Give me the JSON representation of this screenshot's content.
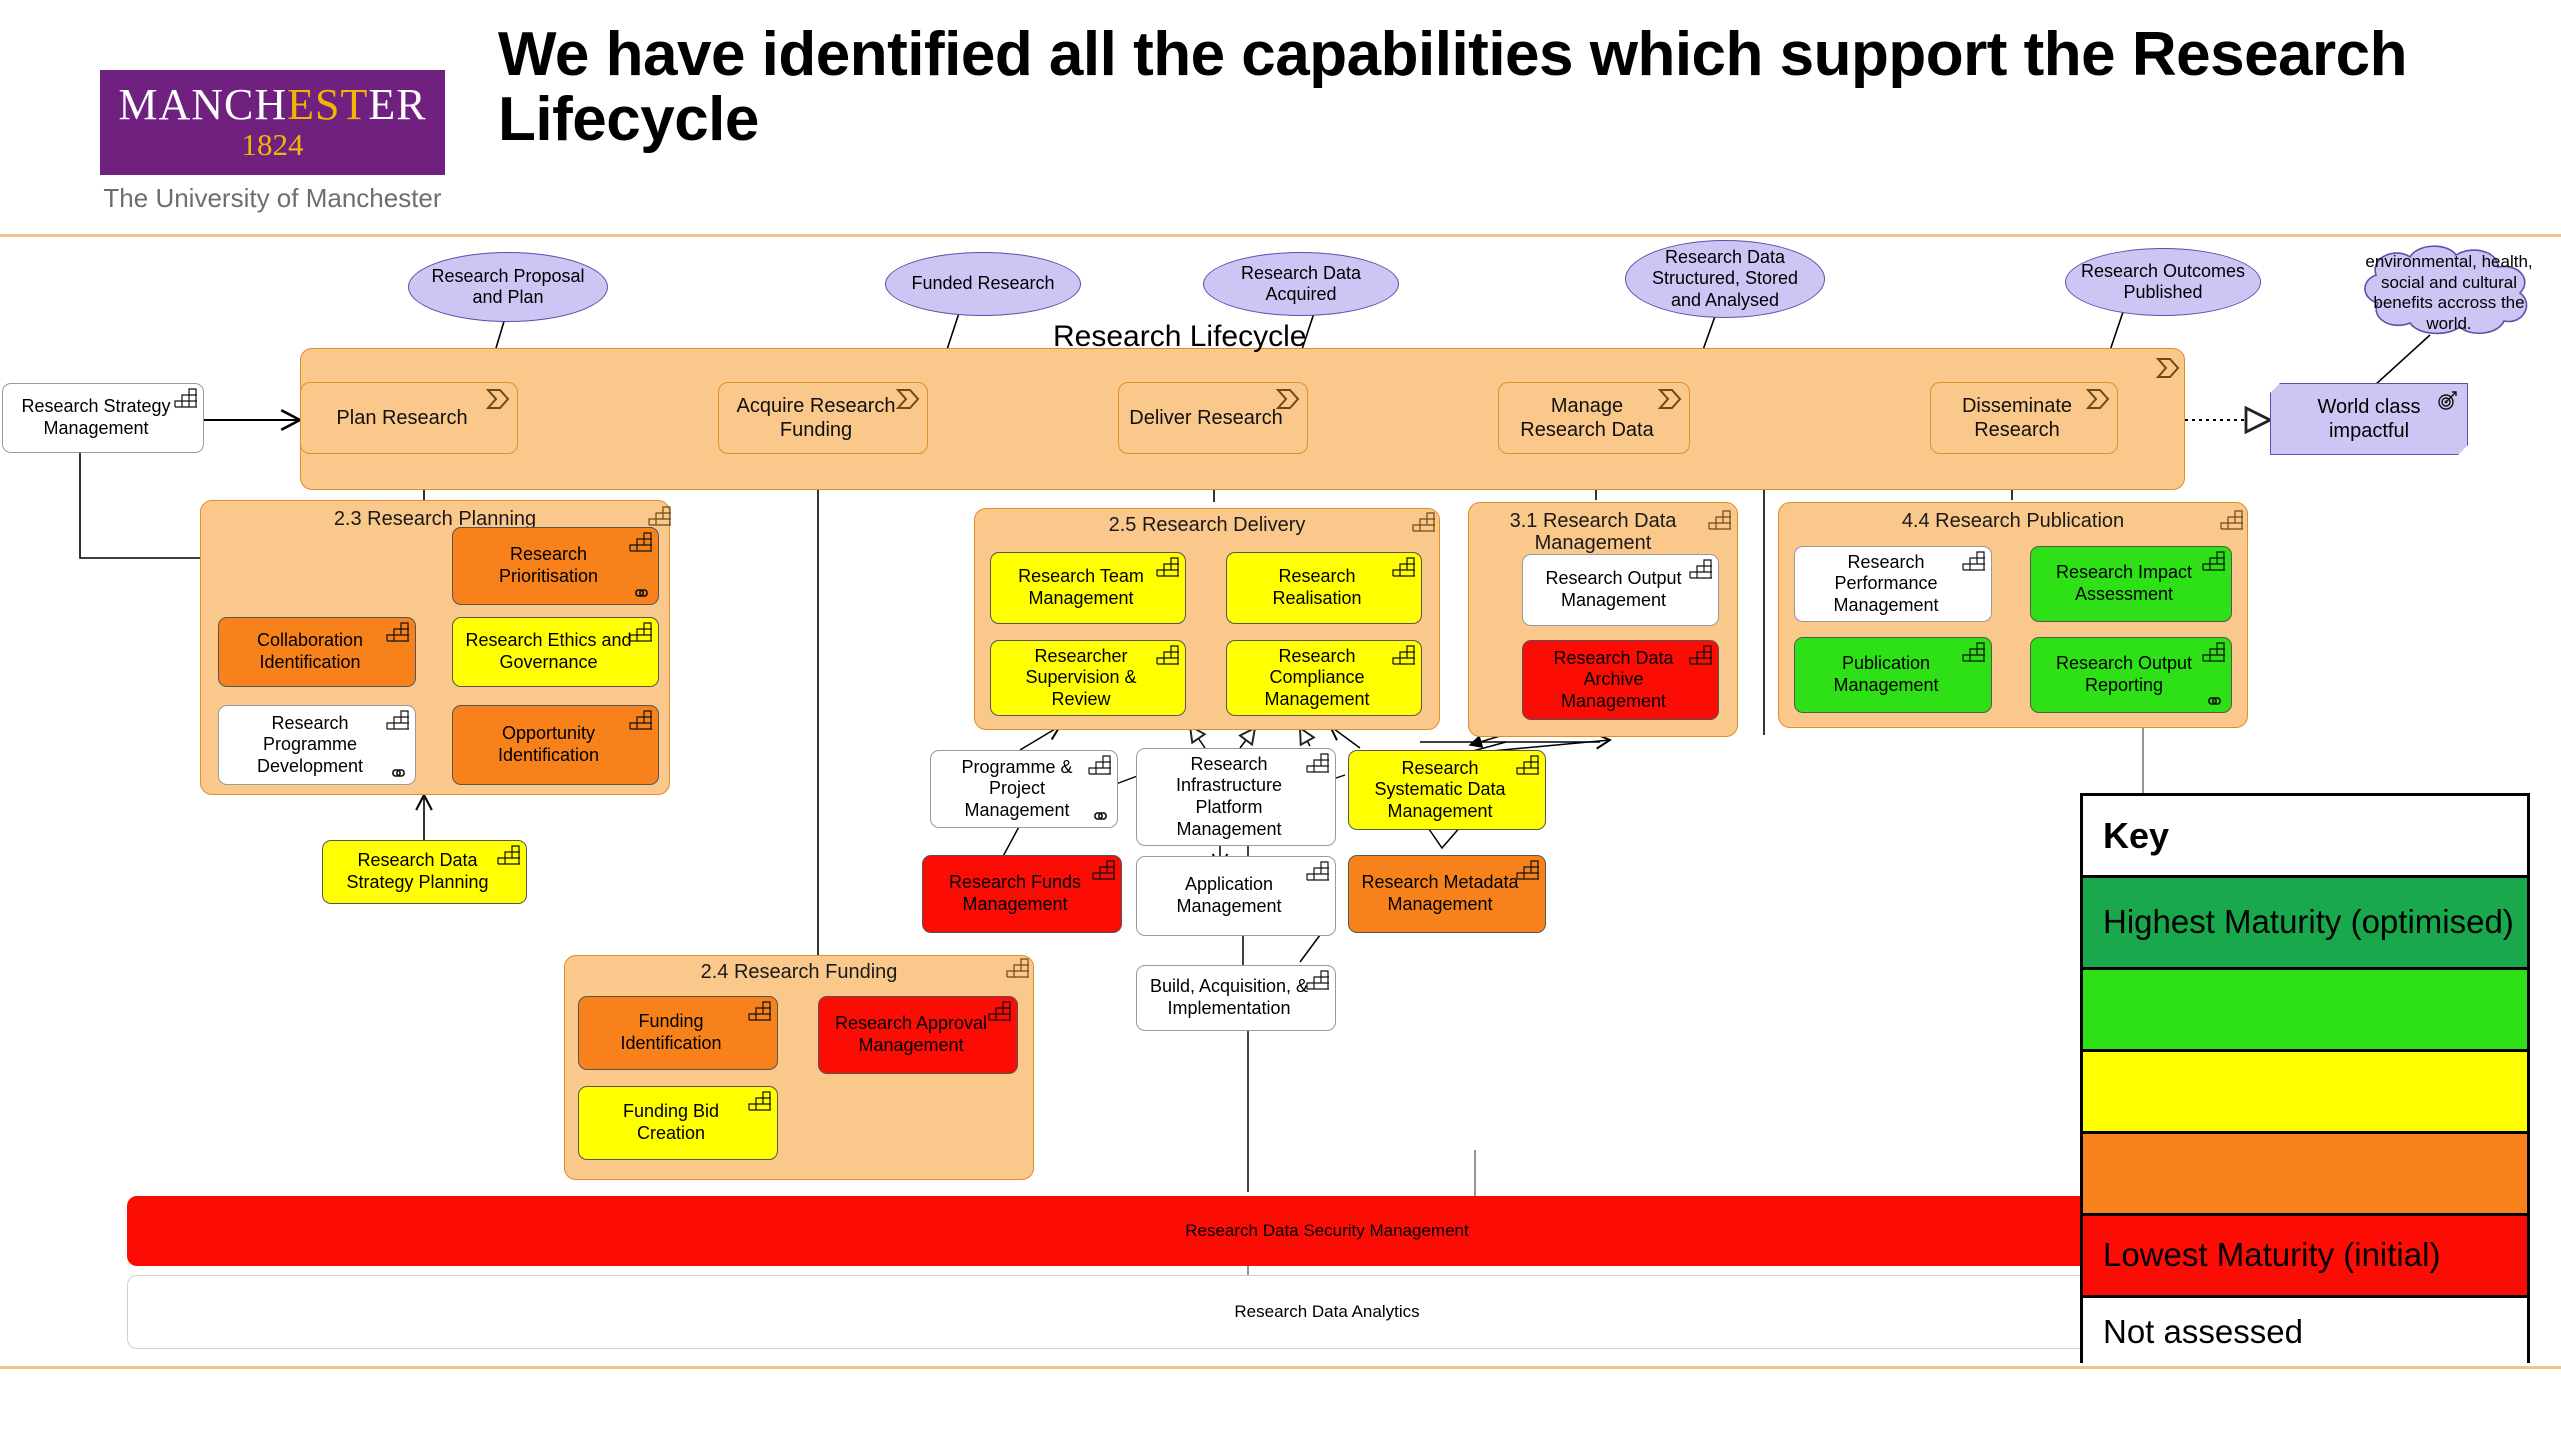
{
  "header": {
    "logo_line1_a": "MANCH",
    "logo_line1_b": "ES",
    "logo_line1_c": "T",
    "logo_line1_d": "ER",
    "logo_year": "1824",
    "logo_subtitle": "The University of Manchester",
    "title": "We have identified all the capabilities which support the Research Lifecycle"
  },
  "diagram": {
    "lifecycle_label": "Research Lifecycle",
    "strategy_box": "Research Strategy Management",
    "processes": [
      {
        "label": "Plan Research"
      },
      {
        "label": "Acquire Research Funding"
      },
      {
        "label": "Deliver Research"
      },
      {
        "label": "Manage Research Data"
      },
      {
        "label": "Disseminate Research"
      }
    ],
    "events": [
      {
        "label": "Research Proposal and Plan"
      },
      {
        "label": "Funded Research"
      },
      {
        "label": "Research Data Acquired"
      },
      {
        "label": "Research Data Structured, Stored and Analysed"
      },
      {
        "label": "Research Outcomes Published"
      }
    ],
    "goal": {
      "label": "World class impactful"
    },
    "note": {
      "label": "environmental, health, social and cultural benefits accross the world."
    },
    "groups": [
      {
        "title": "2.3 Research Planning",
        "items": [
          {
            "label": "Research Prioritisation",
            "colour": "orange",
            "link": true
          },
          {
            "label": "Collaboration Identification",
            "colour": "orange",
            "link": false
          },
          {
            "label": "Research Ethics and Governance",
            "colour": "yellow",
            "link": false
          },
          {
            "label": "Research Programme Development",
            "colour": "white",
            "link": true
          },
          {
            "label": "Opportunity Identification",
            "colour": "orange",
            "link": false
          }
        ]
      },
      {
        "title": "2.5 Research Delivery",
        "items": [
          {
            "label": "Research Team Management",
            "colour": "yellow",
            "link": false
          },
          {
            "label": "Research Realisation",
            "colour": "yellow",
            "link": false
          },
          {
            "label": "Researcher Supervision & Review",
            "colour": "yellow",
            "link": false
          },
          {
            "label": "Research Compliance Management",
            "colour": "yellow",
            "link": false
          }
        ]
      },
      {
        "title": "3.1 Research Data Management",
        "items": [
          {
            "label": "Research Output Management",
            "colour": "white",
            "link": false
          },
          {
            "label": "Research Data Archive Management",
            "colour": "red",
            "link": false
          }
        ]
      },
      {
        "title": "4.4 Research Publication",
        "items": [
          {
            "label": "Research Performance Management",
            "colour": "white",
            "link": false
          },
          {
            "label": "Research Impact Assessment",
            "colour": "green",
            "link": false
          },
          {
            "label": "Publication Management",
            "colour": "green",
            "link": false
          },
          {
            "label": "Research Output Reporting",
            "colour": "green",
            "link": true
          }
        ]
      },
      {
        "title": "2.4 Research Funding",
        "items": [
          {
            "label": "Funding Identification",
            "colour": "orange",
            "link": false
          },
          {
            "label": "Research Approval Management",
            "colour": "red",
            "link": false
          },
          {
            "label": "Funding Bid Creation",
            "colour": "yellow",
            "link": false
          }
        ]
      }
    ],
    "standalone": [
      {
        "label": "Research Data Strategy Planning",
        "colour": "yellow",
        "link": false
      },
      {
        "label": "Programme & Project Management",
        "colour": "white",
        "link": true
      },
      {
        "label": "Research Infrastructure Platform Management",
        "colour": "white",
        "link": false
      },
      {
        "label": "Research Systematic Data Management",
        "colour": "yellow",
        "link": false
      },
      {
        "label": "Research Funds Management",
        "colour": "red",
        "link": false
      },
      {
        "label": "Application Management",
        "colour": "white",
        "link": false
      },
      {
        "label": "Research Metadata Management",
        "colour": "orange",
        "link": false
      },
      {
        "label": "Build, Acquisition, & Implementation",
        "colour": "white",
        "link": false
      }
    ],
    "bars": [
      {
        "label": "Research Data Security Management",
        "colour": "red"
      },
      {
        "label": "Research Data Analytics",
        "colour": "white"
      }
    ]
  },
  "key": {
    "title": "Key",
    "rows": [
      {
        "label": "Highest Maturity (optimised)",
        "colour": "#19a84c"
      },
      {
        "label": "",
        "colour": "#2ee117"
      },
      {
        "label": "",
        "colour": "#ffff00"
      },
      {
        "label": "",
        "colour": "#f7821b"
      },
      {
        "label": "Lowest Maturity (initial)",
        "colour": "#fb0c05"
      },
      {
        "label": "Not assessed",
        "colour": "#ffffff"
      }
    ]
  },
  "colours": {
    "brand_purple": "#70207f",
    "brand_gold": "#f2b600",
    "band_orange": "#fac88b",
    "event_lilac": "#cdc6f5"
  }
}
